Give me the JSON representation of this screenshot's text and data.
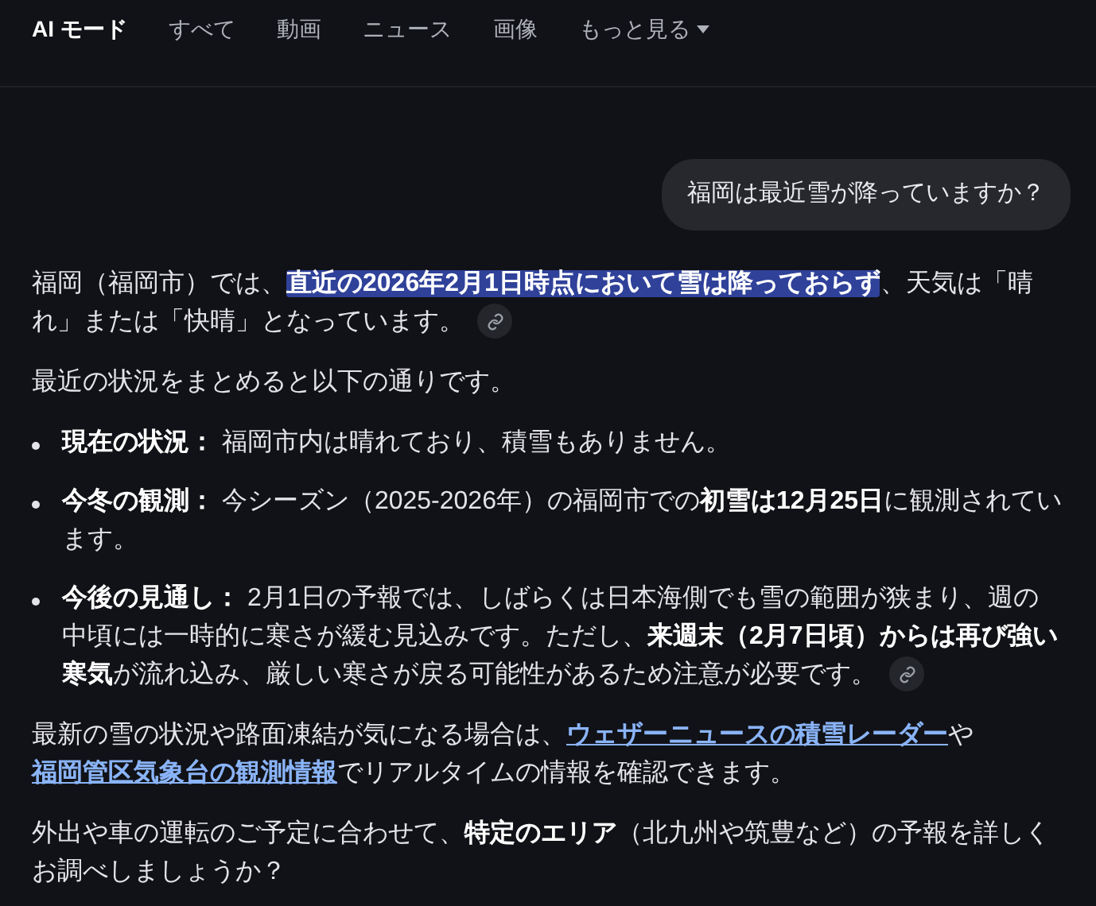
{
  "tabs": [
    {
      "label": "AI モード",
      "selected": true
    },
    {
      "label": "すべて",
      "selected": false
    },
    {
      "label": "動画",
      "selected": false
    },
    {
      "label": "ニュース",
      "selected": false
    },
    {
      "label": "画像",
      "selected": false
    },
    {
      "label": "もっと見る",
      "selected": false,
      "dropdown": true
    }
  ],
  "question": "福岡は最近雪が降っていますか？",
  "answer": [
    {
      "kind": "paragraph",
      "source_link": true,
      "segments": [
        {
          "text": "福岡（福岡市）では、"
        },
        {
          "text": "直近の2026年2月1日時点において雪は降っておらず",
          "bold": true,
          "highlighted": true
        },
        {
          "text": "、天気は「晴れ」または「快晴」となっています。"
        }
      ]
    },
    {
      "kind": "paragraph",
      "source_link": false,
      "segments": [
        {
          "text": "最近の状況をまとめると以下の通りです。"
        }
      ]
    },
    {
      "kind": "bullets",
      "items": [
        {
          "source_link": false,
          "segments": [
            {
              "text": "現在の状況：",
              "bold": true
            },
            {
              "text": " 福岡市内は晴れており、積雪もありません。"
            }
          ]
        },
        {
          "source_link": false,
          "segments": [
            {
              "text": "今冬の観測：",
              "bold": true
            },
            {
              "text": " 今シーズン（2025-2026年）の福岡市での"
            },
            {
              "text": "初雪は12月25日",
              "bold": true
            },
            {
              "text": "に観測されています。"
            }
          ]
        },
        {
          "source_link": true,
          "segments": [
            {
              "text": "今後の見通し：",
              "bold": true
            },
            {
              "text": " 2月1日の予報では、しばらくは日本海側でも雪の範囲が狭まり、週の中頃には一時的に寒さが緩む見込みです。ただし、"
            },
            {
              "text": "来週末（2月7日頃）からは再び強い寒気",
              "bold": true
            },
            {
              "text": "が流れ込み、厳しい寒さが戻る可能性があるため注意が必要です。"
            }
          ]
        }
      ]
    },
    {
      "kind": "paragraph",
      "source_link": false,
      "segments": [
        {
          "text": "最新の雪の状況や路面凍結が気になる場合は、"
        },
        {
          "text": "ウェザーニュースの積雪レーダー",
          "link": true
        },
        {
          "text": "や"
        },
        {
          "text": "福岡管区気象台の観測情報",
          "link": true
        },
        {
          "text": "でリアルタイムの情報を確認できます。"
        }
      ]
    },
    {
      "kind": "paragraph",
      "source_link": false,
      "segments": [
        {
          "text": "外出や車の運転のご予定に合わせて、"
        },
        {
          "text": "特定のエリア",
          "bold": true
        },
        {
          "text": "（北九州や筑豊など）の予報を詳しくお調べしましょうか？"
        }
      ]
    }
  ]
}
